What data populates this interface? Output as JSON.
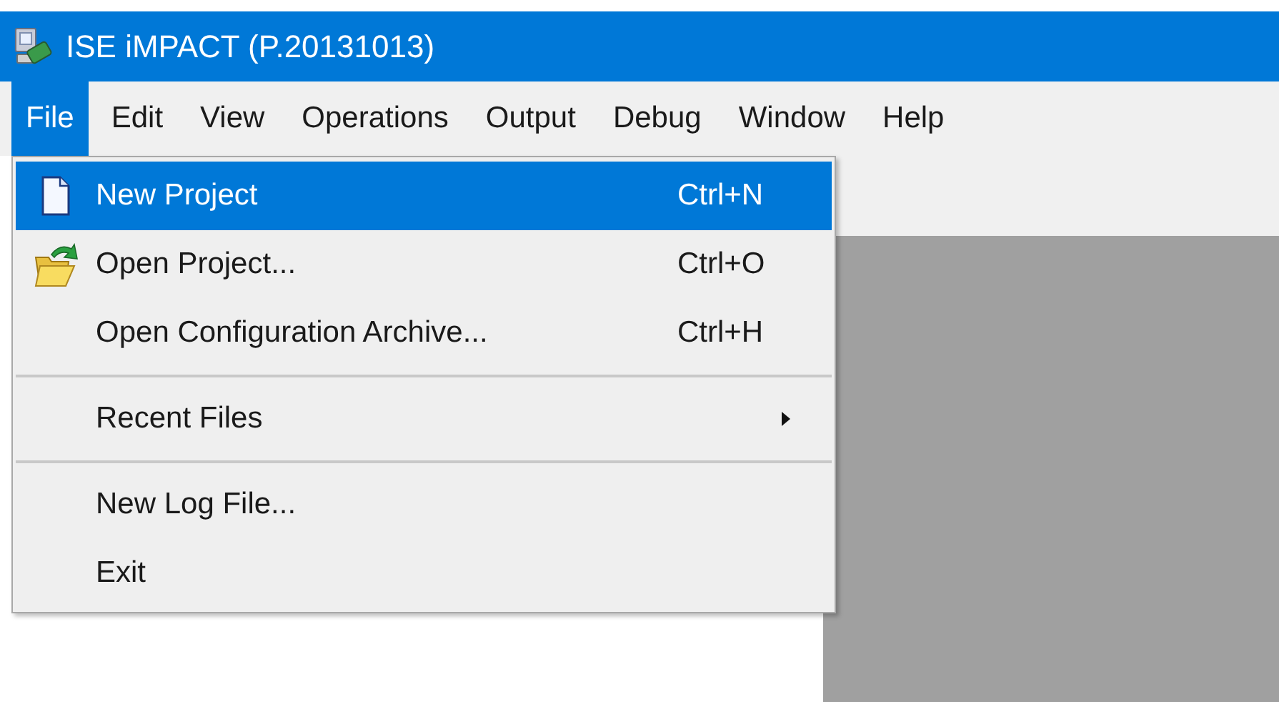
{
  "window": {
    "title": "ISE iMPACT (P.20131013)"
  },
  "menu_bar": [
    {
      "label": "File",
      "selected": true
    },
    {
      "label": "Edit",
      "selected": false
    },
    {
      "label": "View",
      "selected": false
    },
    {
      "label": "Operations",
      "selected": false
    },
    {
      "label": "Output",
      "selected": false
    },
    {
      "label": "Debug",
      "selected": false
    },
    {
      "label": "Window",
      "selected": false
    },
    {
      "label": "Help",
      "selected": false
    }
  ],
  "file_menu": [
    {
      "kind": "item",
      "label": "New Project",
      "shortcut": "Ctrl+N",
      "selected": true
    },
    {
      "kind": "item",
      "label": "Open Project...",
      "shortcut": "Ctrl+O",
      "selected": false
    },
    {
      "kind": "item",
      "label": "Open Configuration Archive...",
      "shortcut": "Ctrl+H",
      "selected": false
    },
    {
      "kind": "separator"
    },
    {
      "kind": "submenu",
      "label": "Recent Files",
      "selected": false
    },
    {
      "kind": "separator"
    },
    {
      "kind": "item",
      "label": "New Log File...",
      "selected": false
    },
    {
      "kind": "item",
      "label": "Exit",
      "selected": false
    }
  ]
}
